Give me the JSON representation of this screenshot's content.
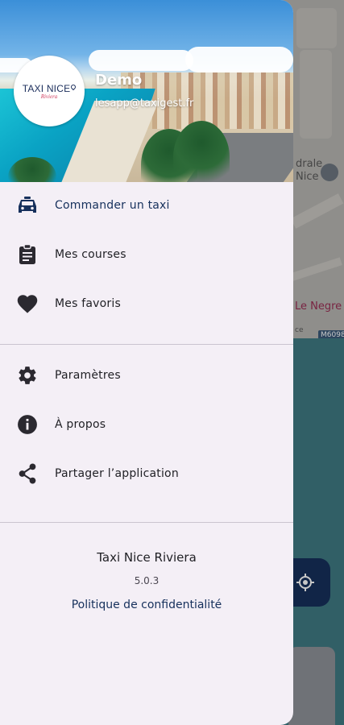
{
  "map": {
    "label_cathedral": "drale\nNice",
    "label_negresco": "Le Negre",
    "road_badge": "M6098",
    "partial_label": "ce"
  },
  "drawer": {
    "header": {
      "logo_main": "TAXI NICE",
      "logo_sub": "Riviera",
      "user_name": "Demo",
      "user_email": "lesapp@taxigest.fr"
    },
    "primary_items": [
      {
        "label": "Commander un taxi",
        "icon": "taxi-icon",
        "active": true
      },
      {
        "label": "Mes courses",
        "icon": "clipboard-icon",
        "active": false
      },
      {
        "label": "Mes favoris",
        "icon": "heart-icon",
        "active": false
      }
    ],
    "secondary_items": [
      {
        "label": "Paramètres",
        "icon": "gear-icon"
      },
      {
        "label": "À propos",
        "icon": "info-icon"
      },
      {
        "label": "Partager l’application",
        "icon": "share-icon"
      }
    ],
    "footer": {
      "app_name": "Taxi Nice Riviera",
      "version": "5.0.3",
      "privacy_link": "Politique de confidentialité"
    }
  },
  "colors": {
    "drawer_bg": "#f4eff6",
    "accent": "#16305c",
    "icon": "#2b2930",
    "brand_pink": "#d03d5f"
  }
}
